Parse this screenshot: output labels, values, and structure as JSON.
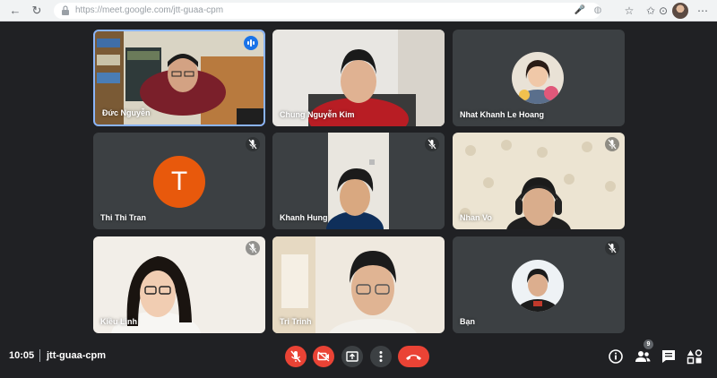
{
  "browser": {
    "url": "https://meet.google.com/jtt-guaa-cpm"
  },
  "participants": [
    {
      "name": "Đức Nguyễn",
      "status": "speaking"
    },
    {
      "name": "Chung Nguyễn Kim",
      "status": "camera-on"
    },
    {
      "name": "Nhat Khanh Le Hoang",
      "status": "avatar-photo"
    },
    {
      "name": "Thi Thi Tran",
      "status": "muted",
      "initial": "T"
    },
    {
      "name": "Khanh Hung",
      "status": "muted"
    },
    {
      "name": "Nhan Vo",
      "status": "muted"
    },
    {
      "name": "Kiều Linh",
      "status": "muted"
    },
    {
      "name": "Tri Trinh",
      "status": "camera-on"
    },
    {
      "name": "Bạn",
      "status": "muted"
    }
  ],
  "meeting": {
    "time": "10:05",
    "code": "jtt-guaa-cpm",
    "people_count": "9"
  },
  "colors": {
    "background": "#202124",
    "tile": "#3c4043",
    "end_call": "#ea4335",
    "avatar_orange": "#e8590c"
  }
}
